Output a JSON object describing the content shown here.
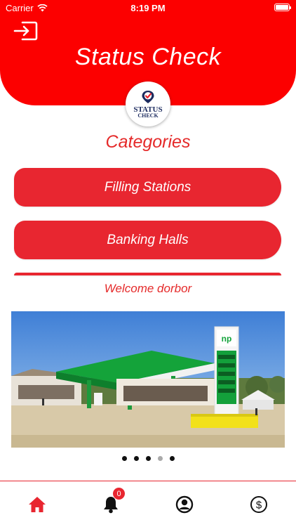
{
  "status_bar": {
    "carrier": "Carrier",
    "time": "8:19 PM"
  },
  "header": {
    "title": "Status Check"
  },
  "logo": {
    "line1": "STATUS",
    "line2": "CHECK"
  },
  "categories": {
    "title": "Categories",
    "items": [
      {
        "label": "Filling Stations"
      },
      {
        "label": "Banking Halls"
      }
    ]
  },
  "welcome": "Welcome dorbor",
  "carousel": {
    "total": 5,
    "active_index": 3
  },
  "station_sign": "np",
  "tabbar": {
    "notifications_badge": "0"
  },
  "colors": {
    "primary": "#fc0000",
    "button": "#e82630",
    "text_accent": "#e52a2a"
  },
  "icons": [
    "logout-icon",
    "wifi-icon",
    "battery-icon",
    "home-icon",
    "bell-icon",
    "profile-icon",
    "dollar-icon"
  ]
}
